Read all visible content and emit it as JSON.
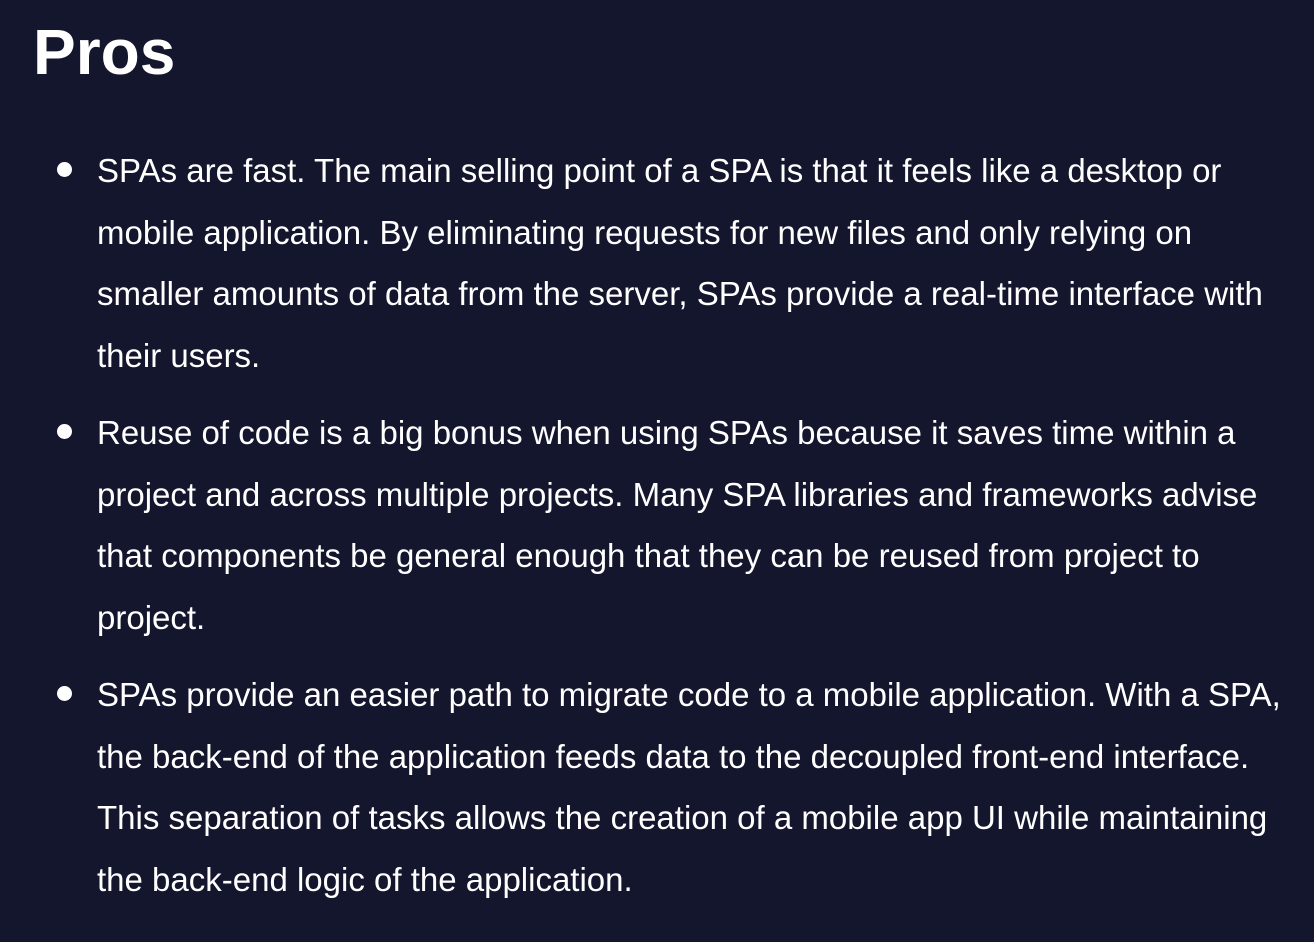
{
  "heading": "Pros",
  "pros": [
    {
      "text": "SPAs are fast. The main selling point of a SPA is that it feels like a desktop or mobile application. By eliminating requests for new files and only relying on smaller amounts of data from the server, SPAs provide a real-time interface with their users."
    },
    {
      "text": "Reuse of code is a big bonus when using SPAs because it saves time within a project and across multiple projects. Many SPA libraries and frameworks advise that components be general enough that they can be reused from project to project."
    },
    {
      "text": "SPAs provide an easier path to migrate code to a mobile application. With a SPA, the back-end of the application feeds data to the decoupled front-end interface. This separation of tasks allows the creation of a mobile app UI while maintaining the back-end logic of the application."
    }
  ],
  "colors": {
    "background": "#13162d",
    "text": "#ffffff"
  }
}
